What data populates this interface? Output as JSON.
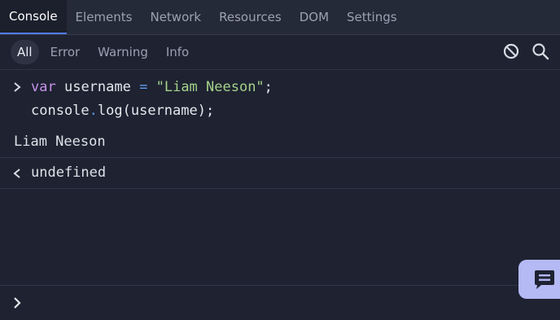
{
  "tabs": [
    {
      "label": "Console",
      "active": true
    },
    {
      "label": "Elements",
      "active": false
    },
    {
      "label": "Network",
      "active": false
    },
    {
      "label": "Resources",
      "active": false
    },
    {
      "label": "DOM",
      "active": false
    },
    {
      "label": "Settings",
      "active": false
    }
  ],
  "filters": [
    {
      "label": "All",
      "active": true
    },
    {
      "label": "Error",
      "active": false
    },
    {
      "label": "Warning",
      "active": false
    },
    {
      "label": "Info",
      "active": false
    }
  ],
  "toolbar_icons": [
    "clear-console-icon",
    "search-icon"
  ],
  "console": {
    "input": {
      "line1": {
        "keyword": "var",
        "identifier": "username",
        "operator": "=",
        "string": "\"Liam Neeson\"",
        "terminator": ";"
      },
      "line2": {
        "object": "console",
        "dot": ".",
        "call": "log(username);"
      }
    },
    "output": "Liam Neeson",
    "result": "undefined"
  },
  "colors": {
    "background": "#1e2231",
    "tabbar": "#252a38",
    "keyword": "#c792ea",
    "operator": "#5d9de8",
    "string": "#a5d38a",
    "accent": "#4f7cf7",
    "feedback": "#b5b9f4"
  }
}
